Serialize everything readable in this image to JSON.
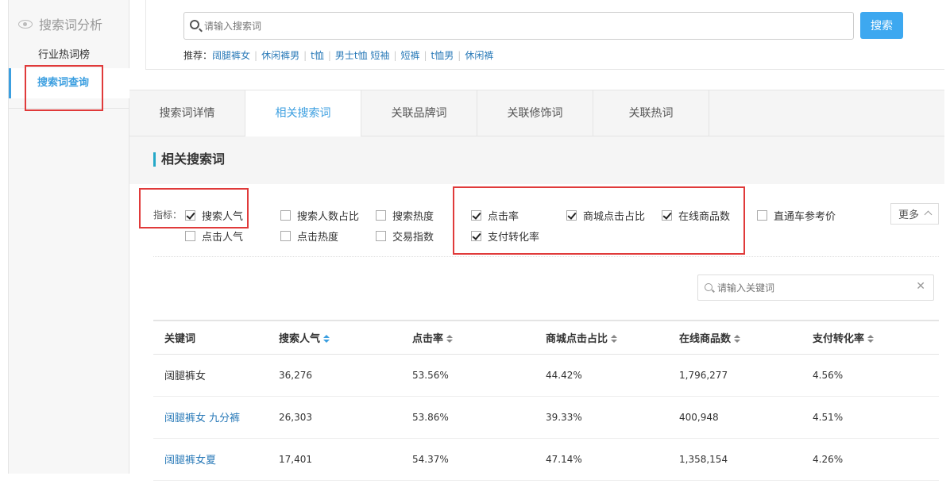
{
  "sidebar": {
    "header": "搜索词分析",
    "items": [
      {
        "label": "行业热词榜"
      },
      {
        "label": "搜索词查询"
      }
    ]
  },
  "search": {
    "placeholder": "请输入搜索词",
    "button": "搜索",
    "recommend_label": "推荐：",
    "recommend_terms": [
      "阔腿裤女",
      "休闲裤男",
      "t恤",
      "男士t恤 短袖",
      "短裤",
      "t恤男",
      "休闲裤"
    ]
  },
  "tabs": [
    {
      "label": "搜索词详情"
    },
    {
      "label": "相关搜索词"
    },
    {
      "label": "关联品牌词"
    },
    {
      "label": "关联修饰词"
    },
    {
      "label": "关联热词"
    }
  ],
  "section_title": "相关搜索词",
  "indicators": {
    "label": "指标：",
    "items": [
      {
        "label": "搜索人气",
        "checked": true
      },
      {
        "label": "点击人气",
        "checked": false
      },
      {
        "label": "搜索人数占比",
        "checked": false
      },
      {
        "label": "点击热度",
        "checked": false
      },
      {
        "label": "搜索热度",
        "checked": false
      },
      {
        "label": "交易指数",
        "checked": false
      },
      {
        "label": "点击率",
        "checked": true
      },
      {
        "label": "支付转化率",
        "checked": true
      },
      {
        "label": "商城点击占比",
        "checked": true
      },
      {
        "label": "在线商品数",
        "checked": true
      },
      {
        "label": "直通车参考价",
        "checked": false
      }
    ],
    "more": "更多"
  },
  "keyword_filter": {
    "placeholder": "请输入关键词"
  },
  "table": {
    "columns": [
      "关键词",
      "搜索人气",
      "点击率",
      "商城点击占比",
      "在线商品数",
      "支付转化率"
    ],
    "rows": [
      [
        "阔腿裤女",
        "36,276",
        "53.56%",
        "44.42%",
        "1,796,277",
        "4.56%"
      ],
      [
        "阔腿裤女 九分裤",
        "26,303",
        "53.86%",
        "39.33%",
        "400,948",
        "4.51%"
      ],
      [
        "阔腿裤女夏",
        "17,401",
        "54.37%",
        "47.14%",
        "1,358,154",
        "4.26%"
      ]
    ]
  },
  "colors": {
    "accent": "#3c9fe0",
    "highlight": "#e03a3a",
    "link": "#2a7ab8"
  }
}
